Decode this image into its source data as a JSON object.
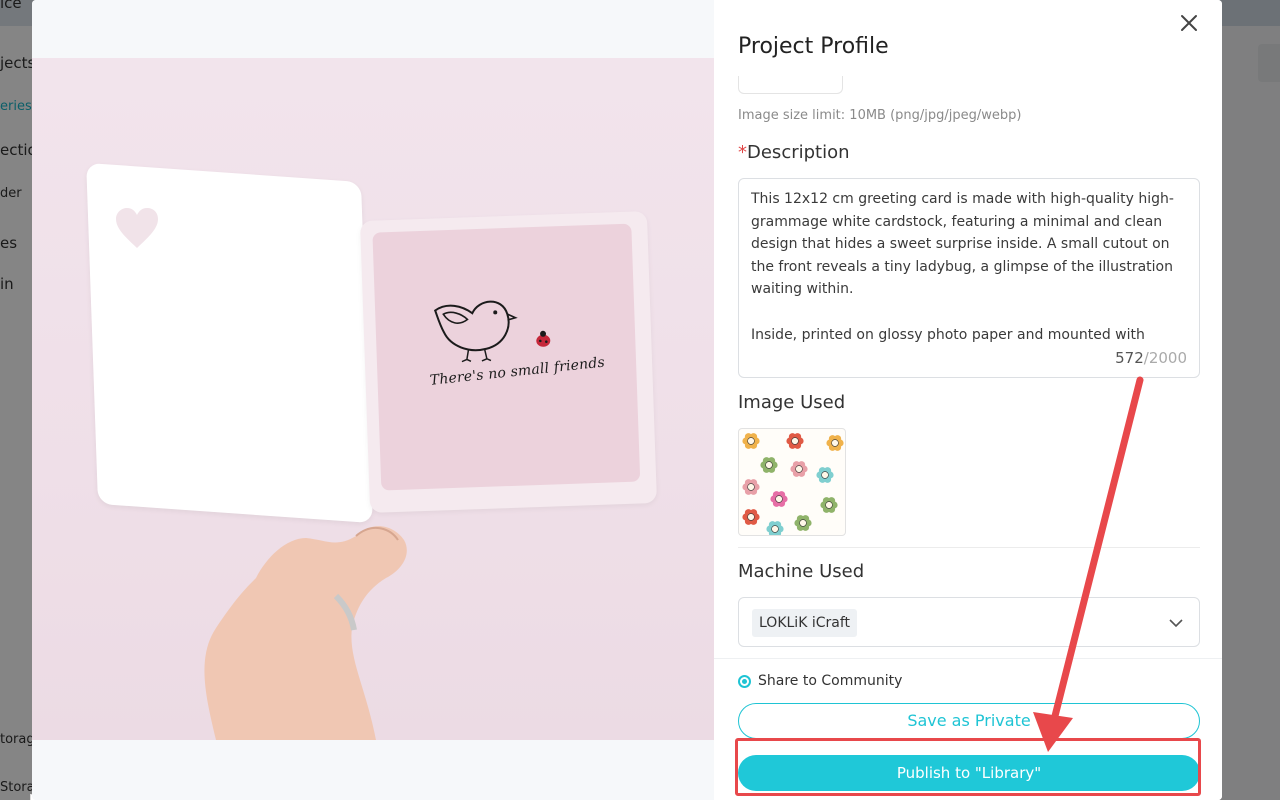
{
  "background": {
    "nav_items": [
      "jects",
      "eries",
      "ectio",
      "der",
      "es",
      "in"
    ],
    "bottom_items": [
      "torag",
      "Stora"
    ],
    "top_left_fragment": "ice"
  },
  "modal": {
    "title": "Project Profile",
    "image_hint": "Image size limit: 10MB (png/jpg/jpeg/webp)",
    "description": {
      "required_mark": "*",
      "label": "Description",
      "text": "This 12x12 cm greeting card is made with high-quality high-grammage white cardstock, featuring a minimal and clean design that hides a sweet surprise inside. A small cutout on the front reveals a tiny ladybug, a glimpse of the illustration waiting within.\n\nInside, printed on glossy photo paper and mounted with care,",
      "count": "572",
      "max": "/2000"
    },
    "image_used_label": "Image Used",
    "machine": {
      "label": "Machine Used",
      "selected": "LOKLiK iCraft"
    },
    "share_label": "Share to Community",
    "save_private_label": "Save as Private",
    "publish_label": "Publish to \"Library\""
  },
  "photo": {
    "card_text": "There's no small friends"
  },
  "colors": {
    "accent": "#1fc8d8",
    "annotation": "#e8484b",
    "required": "#e04646"
  },
  "icons": [
    "close-icon",
    "chevron-down-icon",
    "heart-cutout-icon",
    "bird-illustration",
    "ladybug-icon",
    "flower-pattern-image"
  ]
}
